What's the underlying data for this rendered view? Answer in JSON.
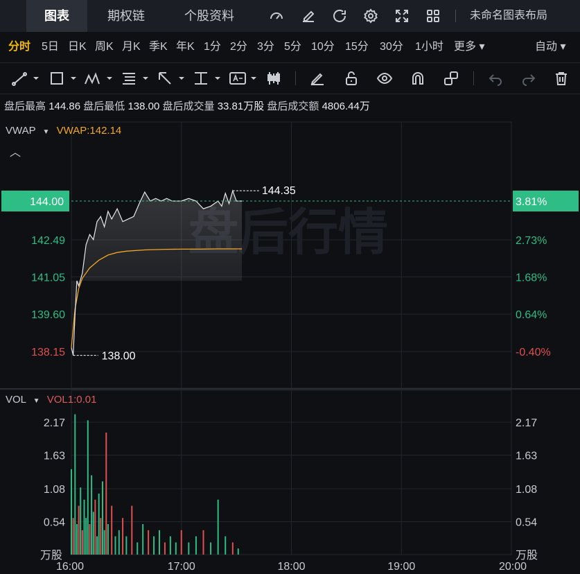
{
  "topbar": {
    "tabs": [
      "图表",
      "期权链",
      "个股资料"
    ],
    "active_tab": "图表",
    "layout_name": "未命名图表布局",
    "tools": [
      "gauge-icon",
      "edit-icon",
      "refresh-icon",
      "settings-icon",
      "fullscreen-icon",
      "grid-layout-icon"
    ]
  },
  "periods": {
    "items": [
      "分时",
      "5日",
      "日K",
      "周K",
      "月K",
      "季K",
      "年K",
      "1分",
      "2分",
      "3分",
      "5分",
      "10分",
      "15分",
      "30分",
      "1小时",
      "更多 ▾"
    ],
    "active": "分时",
    "mode": "自动 ▾"
  },
  "drawing_tools": [
    "line-tool-icon",
    "rect-tool-icon",
    "pattern-tool-icon",
    "fib-tool-icon",
    "arrow-tool-icon",
    "range-tool-icon",
    "text-tool-icon",
    "candle-tool-icon",
    "pen-icon",
    "unlock-icon",
    "eye-icon",
    "magnet-icon",
    "link-icon",
    "undo-icon",
    "redo-icon",
    "trash-icon"
  ],
  "stats": {
    "high_label": "盘后最高",
    "high": "144.86",
    "low_label": "盘后最低",
    "low": "138.00",
    "volume_label": "盘后成交量",
    "volume": "33.81万股",
    "turnover_label": "盘后成交额",
    "turnover": "4806.44万"
  },
  "price_panel": {
    "indicator": "VWAP",
    "indicator_value": "VWAP:142.14",
    "watermark": "盘后行情",
    "current_price": "144.00",
    "current_pct": "3.81%",
    "y_ticks": [
      "142.49",
      "141.05",
      "139.60",
      "138.15"
    ],
    "pct_ticks": [
      "2.73%",
      "1.68%",
      "0.64%",
      "-0.40%"
    ],
    "max_label": "144.35",
    "min_label": "138.00"
  },
  "volume_panel": {
    "indicator": "VOL",
    "indicator_value": "VOL1:0.01",
    "y_ticks": [
      "2.17",
      "1.63",
      "1.08",
      "0.54"
    ],
    "unit": "万股"
  },
  "x_ticks": [
    "16:00",
    "17:00",
    "18:00",
    "19:00",
    "20:00"
  ],
  "colors": {
    "up": "#2ebd85",
    "down": "#e04f4f",
    "accent": "#f0b90b",
    "vwap": "#f5a623",
    "price": "#e8e8e8"
  },
  "chart_data": {
    "type": "line",
    "x_range": [
      "16:00",
      "20:00"
    ],
    "ylim": [
      137.7,
      145.3
    ],
    "price_series": {
      "times": [
        "16:00",
        "16:01",
        "16:02",
        "16:03",
        "16:04",
        "16:06",
        "16:08",
        "16:10",
        "16:12",
        "16:14",
        "16:16",
        "16:18",
        "16:20",
        "16:22",
        "16:25",
        "16:28",
        "16:31",
        "16:34",
        "16:37",
        "16:40",
        "16:43",
        "16:46",
        "16:49",
        "16:52",
        "16:55",
        "16:58",
        "17:00",
        "17:04",
        "17:08",
        "17:12",
        "17:16",
        "17:20",
        "17:22",
        "17:24",
        "17:26",
        "17:28",
        "17:30",
        "17:33"
      ],
      "values": [
        138.3,
        138.0,
        139.6,
        140.9,
        140.7,
        141.2,
        142.3,
        142.7,
        142.5,
        143.2,
        143.4,
        143.0,
        143.6,
        143.3,
        143.7,
        143.2,
        143.3,
        143.4,
        143.9,
        144.35,
        144.0,
        144.1,
        144.0,
        144.1,
        144.0,
        144.0,
        144.0,
        144.1,
        144.0,
        143.7,
        143.8,
        144.0,
        143.8,
        144.3,
        143.9,
        144.4,
        144.0,
        144.0
      ]
    },
    "vwap_series": {
      "times": [
        "16:00",
        "16:02",
        "16:04",
        "16:06",
        "16:10",
        "16:15",
        "16:20",
        "16:25",
        "16:30",
        "16:40",
        "16:50",
        "17:00",
        "17:10",
        "17:20",
        "17:33"
      ],
      "values": [
        138.3,
        139.8,
        140.6,
        141.0,
        141.4,
        141.7,
        141.9,
        142.0,
        142.05,
        142.1,
        142.12,
        142.13,
        142.13,
        142.14,
        142.14
      ]
    },
    "volume_ylim": [
      0,
      2.4
    ],
    "volume_series": {
      "times": [
        "16:00",
        "16:01",
        "16:02",
        "16:03",
        "16:04",
        "16:05",
        "16:06",
        "16:07",
        "16:08",
        "16:09",
        "16:10",
        "16:11",
        "16:12",
        "16:13",
        "16:14",
        "16:15",
        "16:16",
        "16:17",
        "16:18",
        "16:19",
        "16:20",
        "16:22",
        "16:24",
        "16:26",
        "16:28",
        "16:30",
        "16:33",
        "16:36",
        "16:39",
        "16:42",
        "16:45",
        "16:48",
        "16:51",
        "16:54",
        "16:57",
        "17:00",
        "17:04",
        "17:08",
        "17:12",
        "17:16",
        "17:20",
        "17:24",
        "17:28",
        "17:31"
      ],
      "values": [
        1.4,
        0.6,
        2.3,
        0.5,
        0.8,
        1.1,
        0.4,
        0.9,
        0.6,
        2.2,
        0.5,
        1.3,
        0.7,
        0.9,
        0.3,
        1.0,
        0.6,
        1.2,
        0.4,
        2.0,
        0.5,
        0.8,
        0.3,
        0.4,
        0.6,
        0.3,
        0.8,
        0.2,
        0.5,
        0.4,
        0.3,
        0.4,
        0.2,
        0.3,
        0.2,
        0.4,
        0.2,
        0.3,
        0.4,
        0.2,
        0.9,
        0.3,
        0.2,
        0.1
      ],
      "direction": [
        "u",
        "d",
        "u",
        "u",
        "d",
        "u",
        "d",
        "u",
        "u",
        "u",
        "d",
        "u",
        "u",
        "d",
        "u",
        "u",
        "d",
        "u",
        "u",
        "d",
        "u",
        "d",
        "u",
        "u",
        "d",
        "u",
        "d",
        "u",
        "u",
        "d",
        "u",
        "u",
        "d",
        "u",
        "u",
        "d",
        "u",
        "u",
        "d",
        "u",
        "u",
        "u",
        "d",
        "u"
      ]
    }
  }
}
